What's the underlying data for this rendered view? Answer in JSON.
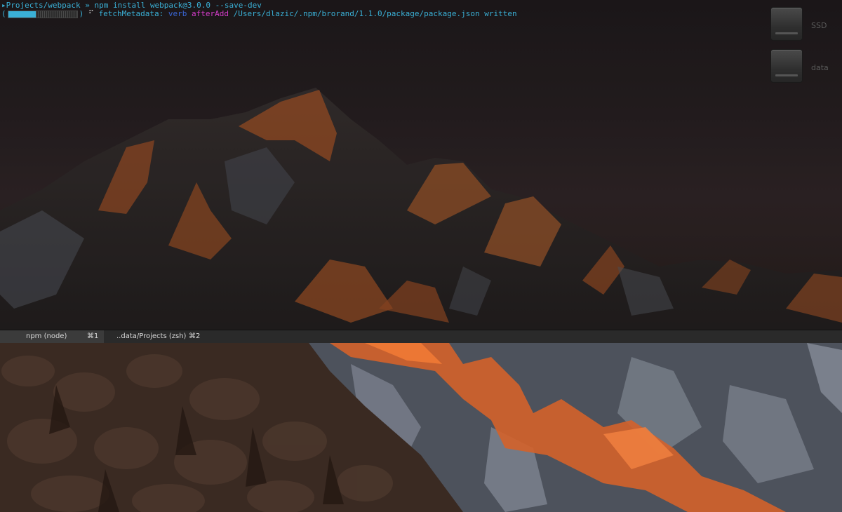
{
  "terminal": {
    "prompt_path": "Projects/webpack",
    "prompt_sep": "»",
    "command": "npm install webpack@3.0.0 --save-dev",
    "progress": {
      "open": "(",
      "close": ")",
      "fraction": 0.4,
      "spinner": "⠋",
      "task": "fetchMetadata:",
      "level": "verb",
      "event": "afterAdd",
      "message": "/Users/dlazic/.npm/brorand/1.1.0/package/package.json written"
    }
  },
  "desktop": {
    "icons": [
      {
        "name": "SSD",
        "icon": "hard-drive-icon"
      },
      {
        "name": "data",
        "icon": "hard-drive-icon"
      }
    ]
  },
  "tabs": [
    {
      "title": "npm (node)",
      "shortcut": "⌘1",
      "active": true
    },
    {
      "title": "..data/Projects (zsh)",
      "shortcut": "⌘2",
      "active": false
    }
  ],
  "colors": {
    "prompt": "#3ab0d6",
    "command": "#3ab0d6",
    "verb": "#3a66d6",
    "event": "#d43cc9",
    "tabbar": "#2a2a2a"
  }
}
